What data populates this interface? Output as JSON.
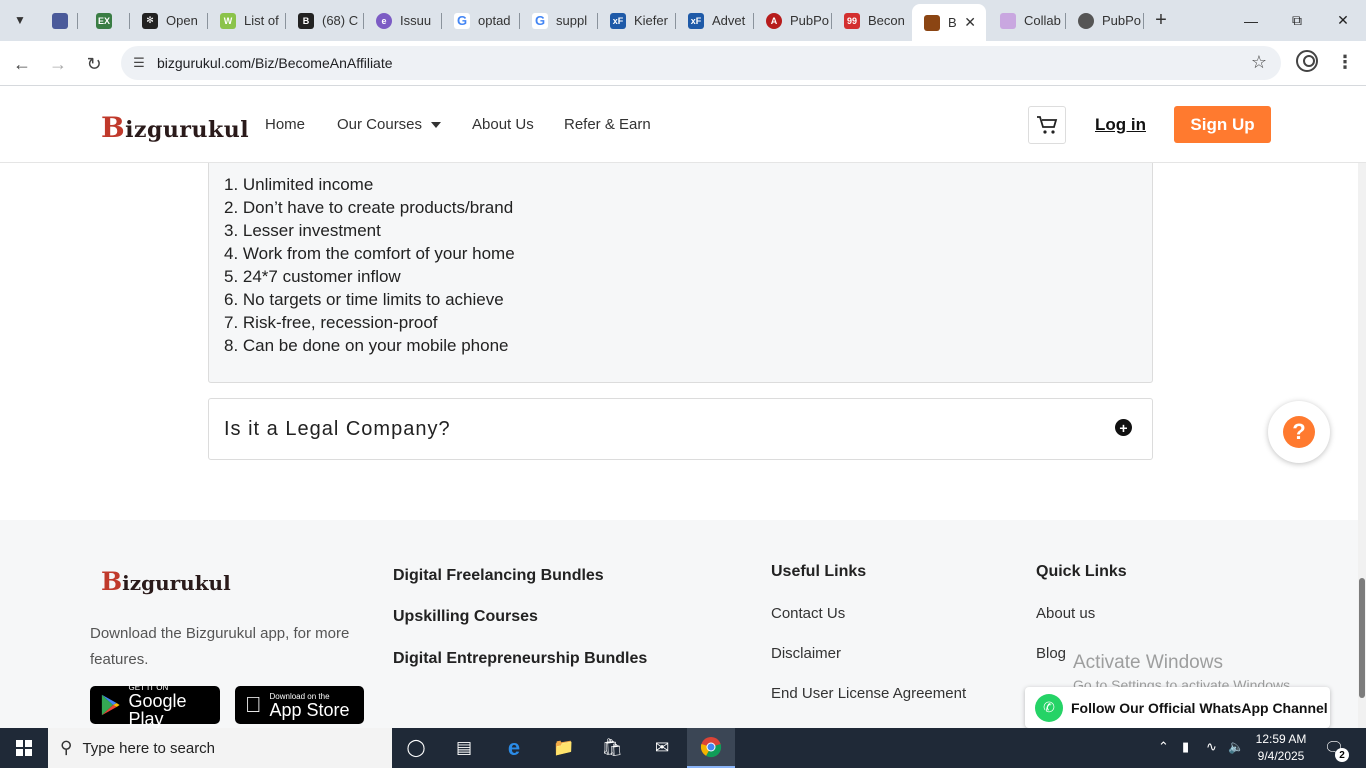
{
  "browser": {
    "tabs": [
      {
        "label": "",
        "favicon_color": "#4a5a9a"
      },
      {
        "label": "",
        "favicon_color": "#3a7d44"
      },
      {
        "label": "Open",
        "favicon_color": "#222222"
      },
      {
        "label": "List of",
        "favicon_color": "#8bc34a"
      },
      {
        "label": "(68) C",
        "favicon_color": "#222222"
      },
      {
        "label": "Issuu",
        "favicon_color": "#7c5cc4"
      },
      {
        "label": "optad",
        "favicon_color": "#4285f4"
      },
      {
        "label": "suppl",
        "favicon_color": "#4285f4"
      },
      {
        "label": "Kiefer",
        "favicon_color": "#1e5aa8"
      },
      {
        "label": "Advet",
        "favicon_color": "#1e5aa8"
      },
      {
        "label": "PubPo",
        "favicon_color": "#b71c1c"
      },
      {
        "label": "Becon",
        "favicon_color": "#d32f2f"
      },
      {
        "label": "B",
        "favicon_color": "#8b4513"
      },
      {
        "label": "Collab",
        "favicon_color": "#c9a7e0"
      },
      {
        "label": "PubPo",
        "favicon_color": "#555555"
      }
    ],
    "url": "bizgurukul.com/Biz/BecomeAnAffiliate"
  },
  "header": {
    "logo_text": "izgurukul",
    "logo_initial": "B",
    "nav": [
      "Home",
      "Our Courses",
      "About Us",
      "Refer & Earn"
    ],
    "login": "Log in",
    "signup": "Sign Up"
  },
  "content": {
    "benefits": [
      "1. Unlimited income",
      "2. Don’t have to create products/brand",
      "3. Lesser investment",
      "4. Work from the comfort of your home",
      "5. 24*7 customer inflow",
      "6. No targets or time limits to achieve",
      "7. Risk-free, recession-proof",
      "8. Can be done on your mobile phone"
    ],
    "faq_question": "Is it a Legal Company?"
  },
  "footer": {
    "description": "Download the Bizgurukul app, for more features.",
    "google_play_small": "GET IT ON",
    "google_play_big": "Google Play",
    "app_store_small": "Download on the",
    "app_store_big": "App Store",
    "bundles": [
      "Digital Freelancing Bundles",
      "Upskilling Courses",
      "Digital Entrepreneurship Bundles"
    ],
    "useful_links_title": "Useful Links",
    "useful_links": [
      "Contact Us",
      "Disclaimer",
      "End User License Agreement"
    ],
    "quick_links_title": "Quick Links",
    "quick_links": [
      "About us",
      "Blog"
    ]
  },
  "overlays": {
    "watermark_title": "Activate Windows",
    "watermark_sub": "Go to Settings to activate Windows.",
    "whatsapp_cta": "Follow Our Official WhatsApp Channel",
    "help_symbol": "?"
  },
  "taskbar": {
    "search_placeholder": "Type here to search",
    "time": "12:59 AM",
    "date": "9/4/2025",
    "notification_count": "2"
  },
  "colors": {
    "accent_orange": "#ff7a2f",
    "whatsapp_green": "#25d366",
    "taskbar": "#1f2937"
  }
}
